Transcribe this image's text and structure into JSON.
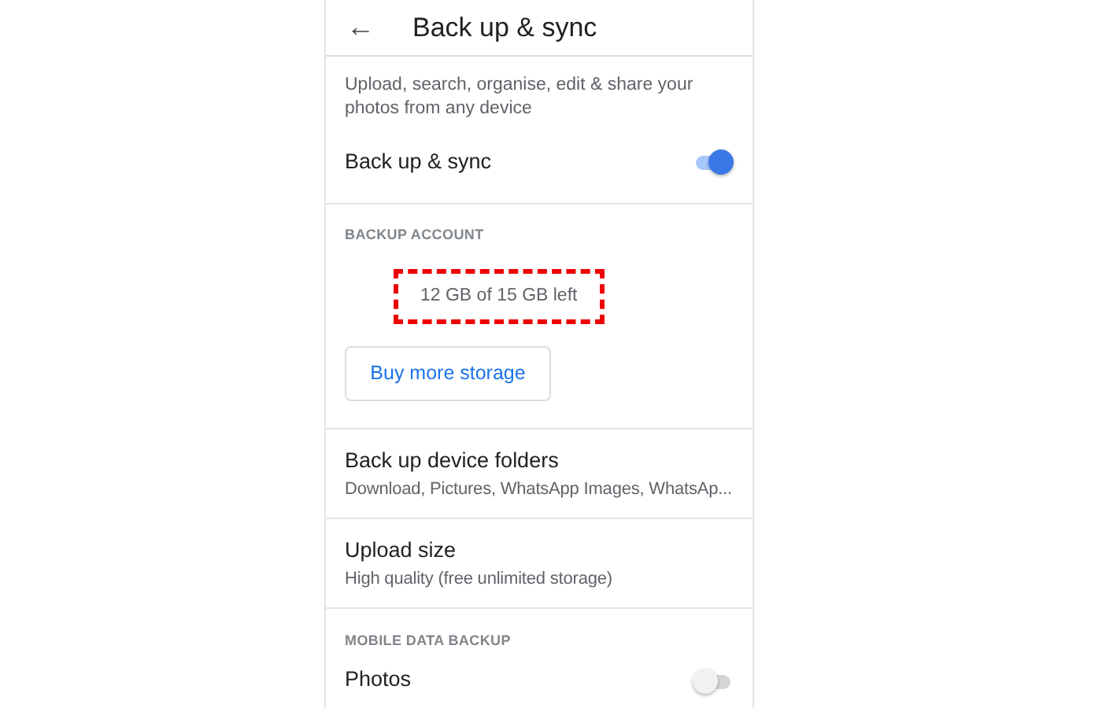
{
  "header": {
    "back_glyph": "←",
    "title": "Back up & sync"
  },
  "description": "Upload, search, organise, edit & share your photos from any device",
  "backup_sync": {
    "label": "Back up & sync",
    "on": true
  },
  "backup_account": {
    "heading": "BACKUP ACCOUNT",
    "storage": {
      "text": "12 GB of 15 GB left",
      "highlighted": true
    },
    "button": "Buy more storage"
  },
  "settings": [
    {
      "title": "Back up device folders",
      "subtitle": "Download, Pictures, WhatsApp Images, WhatsAp..."
    },
    {
      "title": "Upload size",
      "subtitle": "High quality (free unlimited storage)"
    }
  ],
  "mobile_data_backup": {
    "heading": "MOBILE DATA BACKUP",
    "items": [
      {
        "label": "Photos",
        "on": false
      }
    ]
  }
}
